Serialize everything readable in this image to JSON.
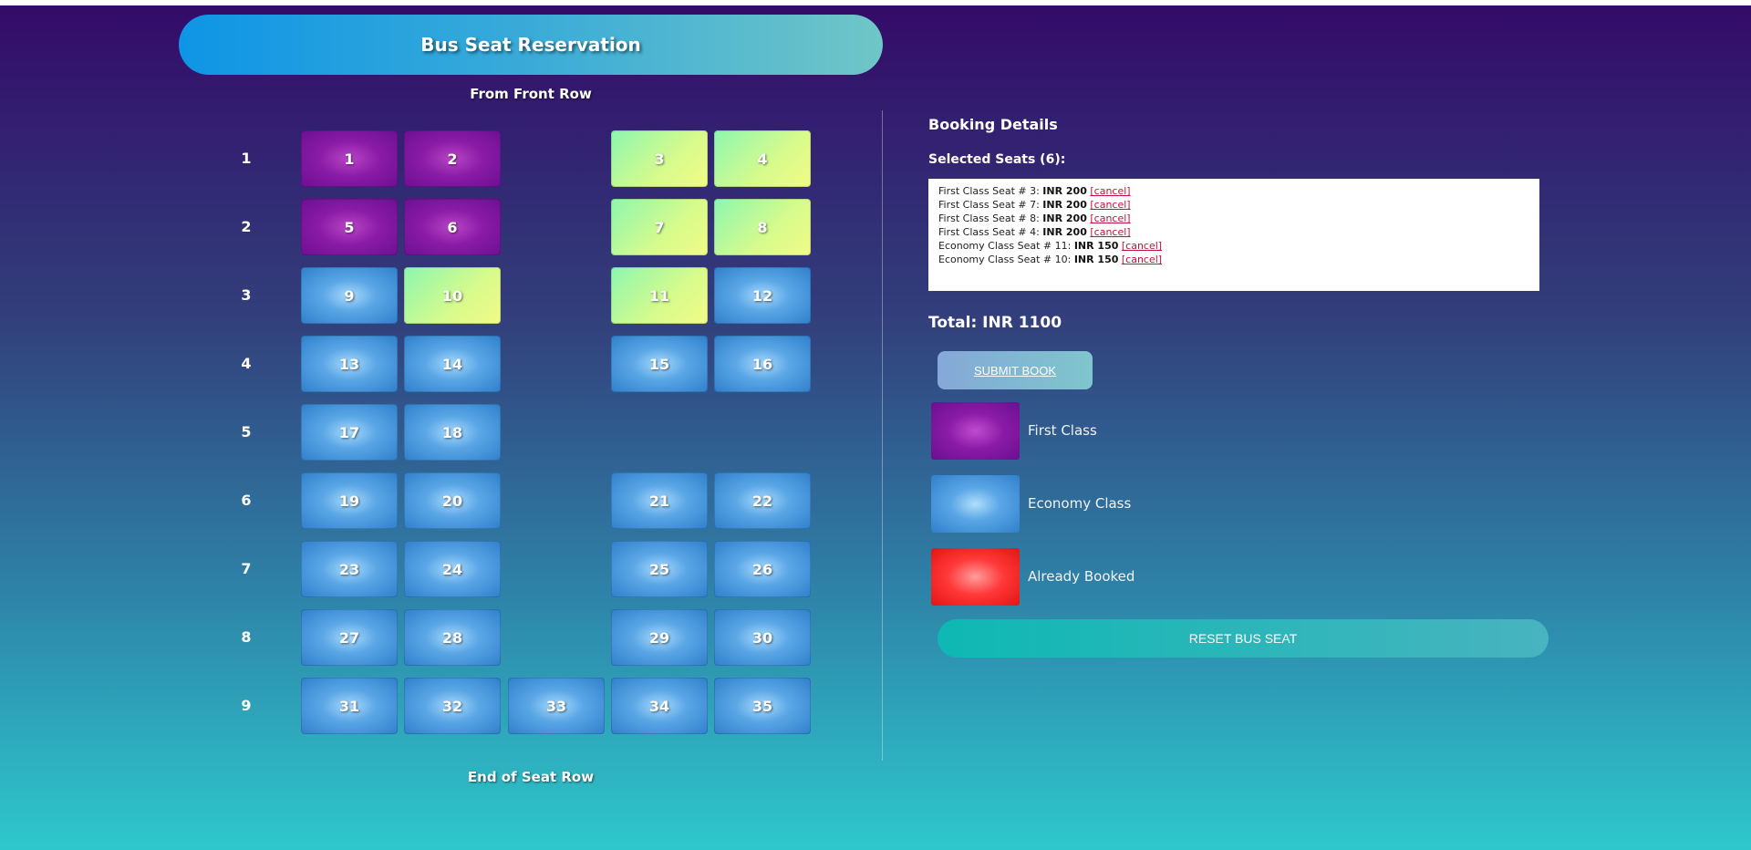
{
  "title": "Bus Seat Reservation",
  "front_label": "From Front Row",
  "end_label": "End of Seat Row",
  "rows": [
    "1",
    "2",
    "3",
    "4",
    "5",
    "6",
    "7",
    "8",
    "9"
  ],
  "seats": [
    {
      "num": "1",
      "class": "first"
    },
    {
      "num": "2",
      "class": "first"
    },
    {
      "num": "3",
      "class": "selected"
    },
    {
      "num": "4",
      "class": "selected"
    },
    {
      "num": "5",
      "class": "first"
    },
    {
      "num": "6",
      "class": "first"
    },
    {
      "num": "7",
      "class": "selected"
    },
    {
      "num": "8",
      "class": "selected"
    },
    {
      "num": "9",
      "class": "economy"
    },
    {
      "num": "10",
      "class": "selected"
    },
    {
      "num": "11",
      "class": "selected"
    },
    {
      "num": "12",
      "class": "economy"
    },
    {
      "num": "13",
      "class": "economy"
    },
    {
      "num": "14",
      "class": "economy"
    },
    {
      "num": "15",
      "class": "economy"
    },
    {
      "num": "16",
      "class": "economy"
    },
    {
      "num": "17",
      "class": "economy"
    },
    {
      "num": "18",
      "class": "economy"
    },
    {
      "num": "19",
      "class": "economy"
    },
    {
      "num": "20",
      "class": "economy"
    },
    {
      "num": "21",
      "class": "economy"
    },
    {
      "num": "22",
      "class": "economy"
    },
    {
      "num": "23",
      "class": "economy"
    },
    {
      "num": "24",
      "class": "economy"
    },
    {
      "num": "25",
      "class": "economy"
    },
    {
      "num": "26",
      "class": "economy"
    },
    {
      "num": "27",
      "class": "economy"
    },
    {
      "num": "28",
      "class": "economy"
    },
    {
      "num": "29",
      "class": "economy"
    },
    {
      "num": "30",
      "class": "economy"
    },
    {
      "num": "31",
      "class": "economy"
    },
    {
      "num": "32",
      "class": "economy"
    },
    {
      "num": "33",
      "class": "economy"
    },
    {
      "num": "34",
      "class": "economy"
    },
    {
      "num": "35",
      "class": "economy"
    }
  ],
  "booking": {
    "title": "Booking Details",
    "selected_title": "Selected Seats (6):",
    "selected": [
      {
        "label": "First Class Seat # 3:",
        "price": "INR 200"
      },
      {
        "label": "First Class Seat # 7:",
        "price": "INR 200"
      },
      {
        "label": "First Class Seat # 8:",
        "price": "INR 200"
      },
      {
        "label": "First Class Seat # 4:",
        "price": "INR 200"
      },
      {
        "label": "Economy Class Seat # 11:",
        "price": "INR 150"
      },
      {
        "label": "Economy Class Seat # 10:",
        "price": "INR 150"
      }
    ],
    "cancel_label": "[cancel]",
    "total": "Total: INR 1100",
    "submit_label": "SUBMIT BOOK",
    "reset_label": "RESET BUS SEAT"
  },
  "legend": {
    "first": "First Class",
    "economy": "Economy Class",
    "booked": "Already Booked"
  }
}
